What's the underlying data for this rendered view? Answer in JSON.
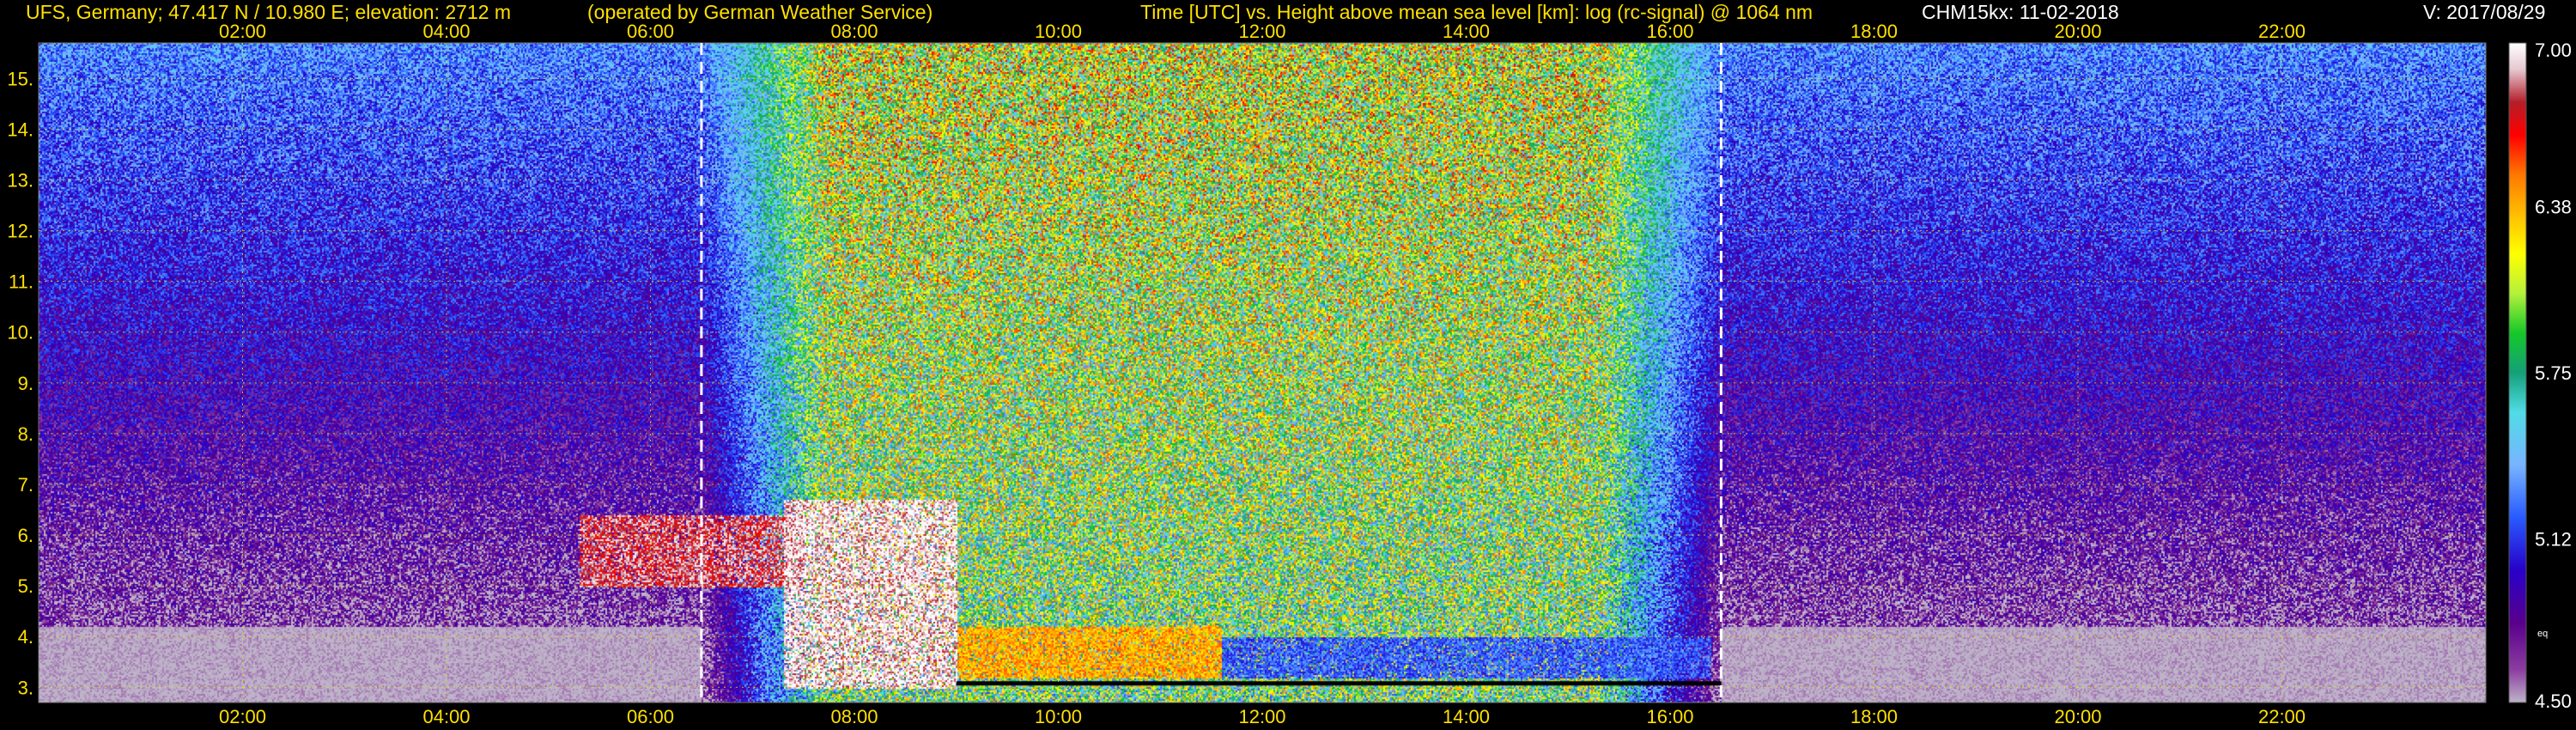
{
  "header": {
    "site": "UFS, Germany; 47.417 N / 10.980 E; elevation: 2712 m",
    "operator": "(operated by German Weather Service)",
    "axes_title": "Time [UTC] vs. Height above mean sea level [km]: log (rc-signal) @ 1064 nm",
    "instrument": "CHM15kx: 11-02-2018",
    "version": "V: 2017/08/29"
  },
  "colors": {
    "background": "#000000",
    "header_text": "#ffe000",
    "header_text_alt": "#ffffff",
    "grid": "#e6e600",
    "marker_lines": "#ffffff"
  },
  "chart_data": {
    "type": "heatmap",
    "title": "Time [UTC] vs. Height above mean sea level [km]: log (rc-signal) @ 1064 nm",
    "x_unit": "UTC hour",
    "xlim": [
      0,
      24
    ],
    "x_ticks": [
      2,
      4,
      6,
      8,
      10,
      12,
      14,
      16,
      18,
      20,
      22
    ],
    "x_tick_labels": [
      "02:00",
      "04:00",
      "06:00",
      "08:00",
      "10:00",
      "12:00",
      "14:00",
      "16:00",
      "18:00",
      "20:00",
      "22:00"
    ],
    "y_unit": "km",
    "ylim": [
      2.7,
      15.7
    ],
    "y_ticks": [
      3,
      4,
      5,
      6,
      7,
      8,
      9,
      10,
      11,
      12,
      13,
      14,
      15
    ],
    "y_tick_labels": [
      "3.",
      "4.",
      "5.",
      "6.",
      "7.",
      "8.",
      "9.",
      "10.",
      "11.",
      "12.",
      "13.",
      "14.",
      "15."
    ],
    "grid": true,
    "marker_times": [
      6.5,
      16.5
    ],
    "colorbar": {
      "min": 4.5,
      "max": 7.0,
      "tick_values": [
        7.0,
        6.38,
        5.75,
        5.12,
        4.5
      ],
      "tick_labels": [
        "7.00",
        "6.38",
        "5.75",
        "5.12",
        "4.50"
      ],
      "unit_label": "eq"
    },
    "features": [
      {
        "kind": "cloud",
        "t": [
          5.3,
          7.5
        ],
        "h": [
          5.0,
          6.4
        ],
        "level": 6.8
      },
      {
        "kind": "cloud",
        "t": [
          7.3,
          9.0
        ],
        "h": [
          3.0,
          6.7
        ],
        "level": 6.95
      },
      {
        "kind": "boundary_layer",
        "t": [
          9.0,
          11.6
        ],
        "h": [
          3.2,
          4.2
        ],
        "level": 6.4
      },
      {
        "kind": "boundary_layer",
        "t": [
          11.6,
          16.4
        ],
        "h": [
          3.2,
          4.0
        ],
        "level": 5.2
      },
      {
        "kind": "noise_day",
        "t": [
          6.5,
          16.5
        ],
        "h": [
          7.0,
          15.7
        ],
        "level": 6.3
      }
    ]
  }
}
